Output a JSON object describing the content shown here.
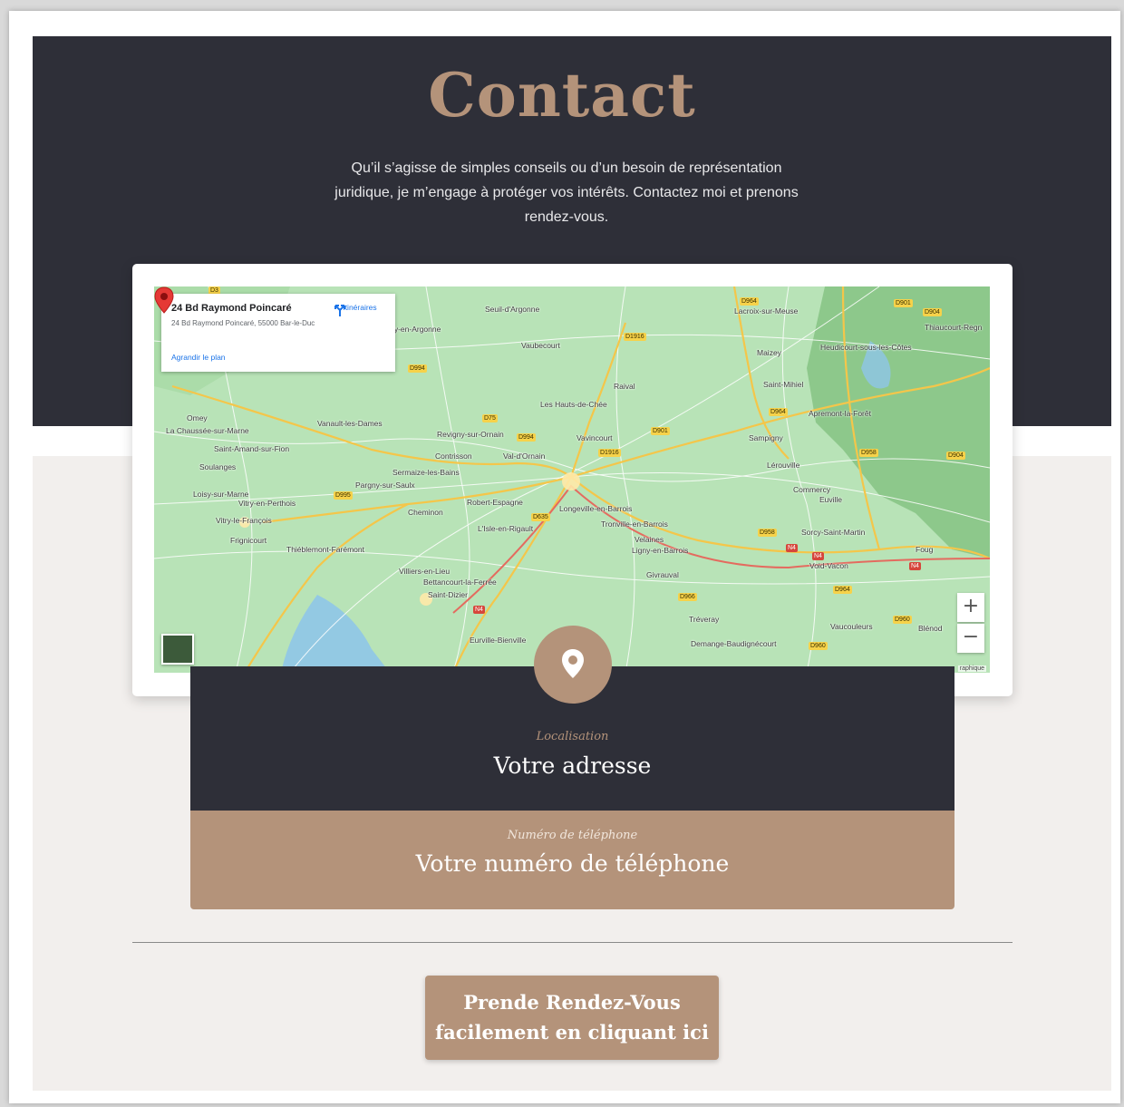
{
  "header": {
    "title": "Contact",
    "intro_line1": "Qu’il s’agisse de simples conseils ou d’un besoin de représentation",
    "intro_line2": "juridique, je m’engage à protéger vos intérêts. Contactez moi et prenons",
    "intro_line3": "rendez-vous."
  },
  "map": {
    "place_title": "24 Bd Raymond Poincaré",
    "place_address": "24 Bd Raymond Poincaré, 55000 Bar-le-Duc",
    "directions_label": "Itinéraires",
    "enlarge_label": "Agrandir le plan",
    "zoom_in": "+",
    "zoom_out": "−",
    "attribution": "raphique",
    "towns": [
      "Seuil-d'Argonne",
      "Vaubecourt",
      "Lacroix-sur-Meuse",
      "Thiaucourt-Regn",
      "Maizey",
      "Heudicourt-sous-les-Côtes",
      "Saint-Mihiel",
      "Raival",
      "Les Hauts-de-Chée",
      "Apremont-la-Forêt",
      "Omey",
      "La Chaussée-sur-Marne",
      "Vanault-les-Dames",
      "Revigny-sur-Ornain",
      "Vavincourt",
      "Sampigny",
      "Saint-Amand-sur-Fion",
      "Contrisson",
      "Val-d'Ornain",
      "Lérouville",
      "Soulanges",
      "Sermaize-les-Bains",
      "Pargny-sur-Saulx",
      "Commercy",
      "Euville",
      "Loisy-sur-Marne",
      "Vitry-en-Perthois",
      "Robert-Espagne",
      "Cheminon",
      "Longeville-en-Barrois",
      "Vitry-le-François",
      "L'Isle-en-Rigault",
      "Tronville-en-Barrois",
      "Sorcy-Saint-Martin",
      "Frignicourt",
      "Velaines",
      "Ligny-en-Barrois",
      "Thiéblemont-Farémont",
      "Foug",
      "Void-Vacon",
      "Villiers-en-Lieu",
      "Givrauval",
      "Bettancourt-la-Ferrée",
      "Saint-Dizier",
      "Tréveray",
      "Vaucouleurs",
      "Blénod",
      "Eurville-Bienville",
      "Demange-Baudignécourt",
      "ry-en-Argonne"
    ],
    "roads": [
      "D3",
      "D964",
      "D901",
      "D904",
      "D1916",
      "D994",
      "D75",
      "D994",
      "D901",
      "D1916",
      "D958",
      "D904",
      "D964",
      "D995",
      "D635",
      "D958",
      "N4",
      "N4",
      "N4",
      "D964",
      "D966",
      "N4",
      "D960",
      "D960"
    ]
  },
  "location": {
    "sublabel": "Localisation",
    "label": "Votre adresse"
  },
  "phone": {
    "sublabel": "Numéro de téléphone",
    "label": "Votre numéro de téléphone"
  },
  "cta": {
    "line1": "Prende Rendez-Vous",
    "line2": "facilement en cliquant ici"
  },
  "colors": {
    "dark": "#2e2f38",
    "accent": "#b4937a",
    "light_bg": "#f2efed"
  }
}
